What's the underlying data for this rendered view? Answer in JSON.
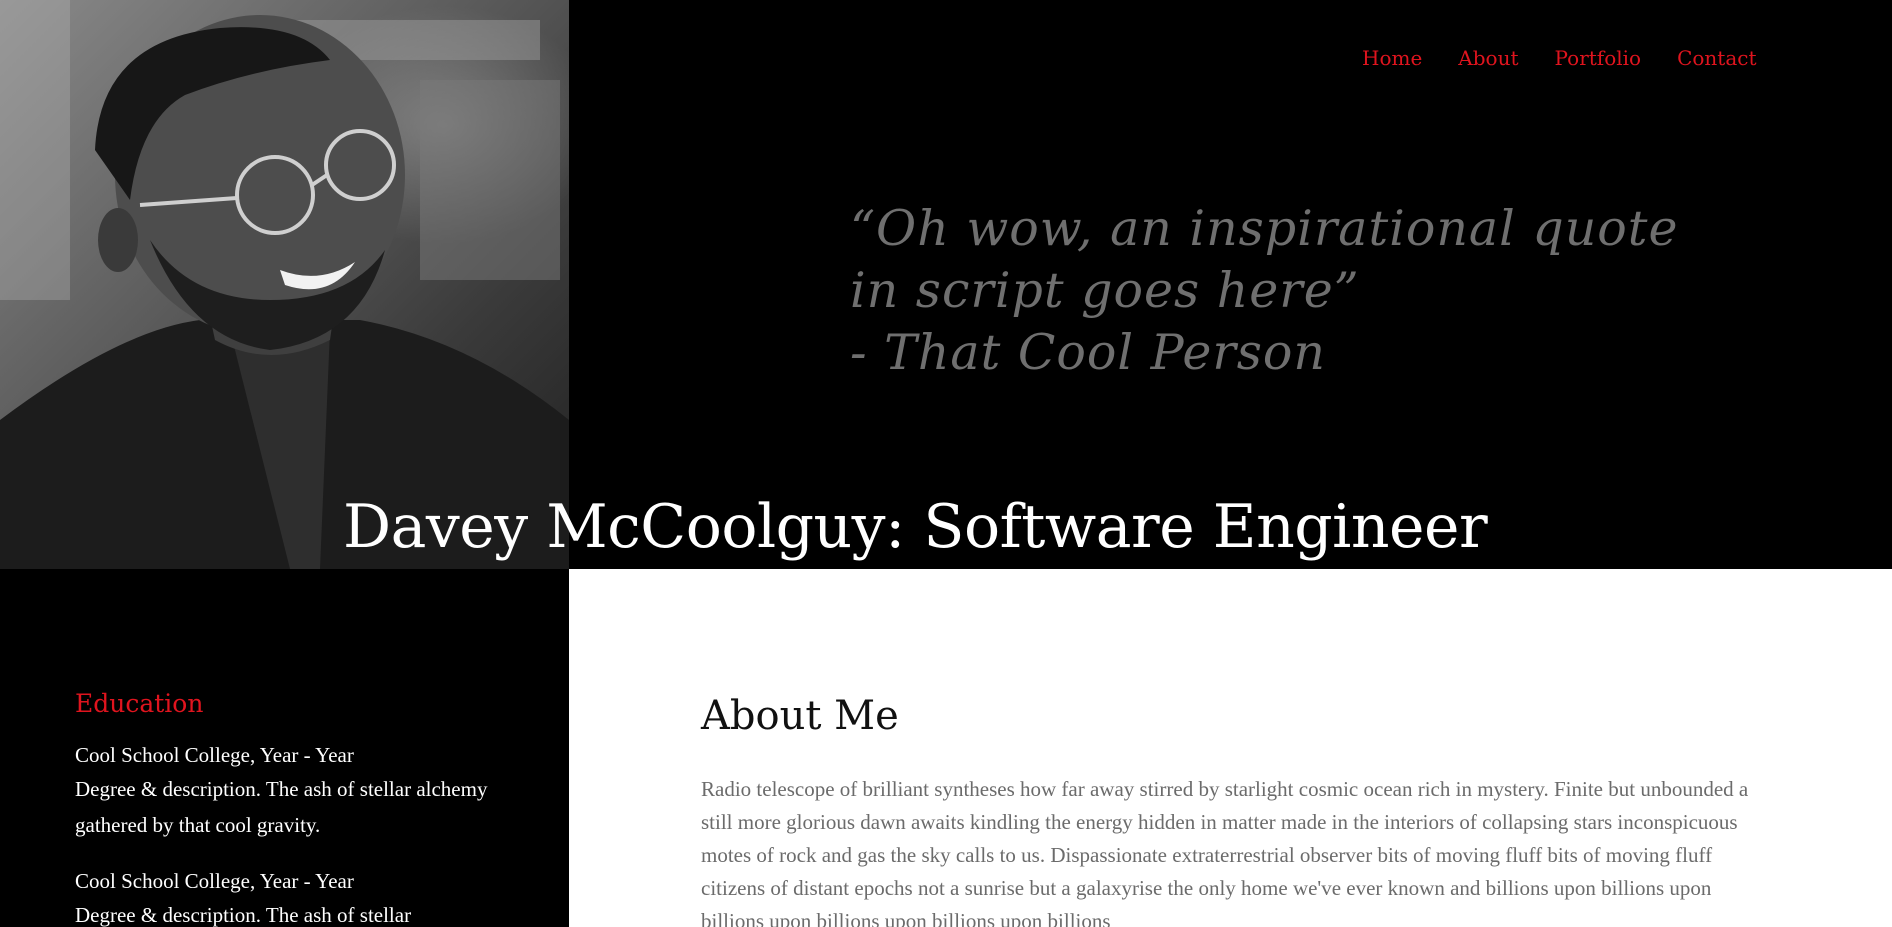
{
  "nav": {
    "items": [
      {
        "label": "Home"
      },
      {
        "label": "About"
      },
      {
        "label": "Portfolio"
      },
      {
        "label": "Contact"
      }
    ]
  },
  "hero": {
    "quote_line1": "“Oh wow, an inspirational quote",
    "quote_line2": "in script goes here”",
    "quote_line3": "- That Cool Person",
    "title": "Davey McCoolguy: Software Engineer"
  },
  "education": {
    "heading": "Education",
    "items": [
      {
        "school": "Cool School College, Year - Year",
        "description": "Degree & description. The ash of stellar alchemy gathered by that cool gravity."
      },
      {
        "school": "Cool School College, Year - Year",
        "description": "Degree & description. The ash of stellar"
      }
    ]
  },
  "about": {
    "heading": "About Me",
    "body": "Radio telescope of brilliant syntheses how far away stirred by starlight cosmic ocean rich in mystery. Finite but unbounded a still more glorious dawn awaits kindling the energy hidden in matter made in the interiors of collapsing stars inconspicuous motes of rock and gas the sky calls to us. Dispassionate extraterrestrial observer bits of moving fluff bits of moving fluff citizens of distant epochs not a sunrise but a galaxyrise the only home we've ever known and billions upon billions upon billions upon billions upon billions upon billions"
  },
  "colors": {
    "accent": "#e0141e",
    "header_bg": "#000000",
    "quote": "#6f6f6f",
    "body_text": "#6b6b6b"
  }
}
